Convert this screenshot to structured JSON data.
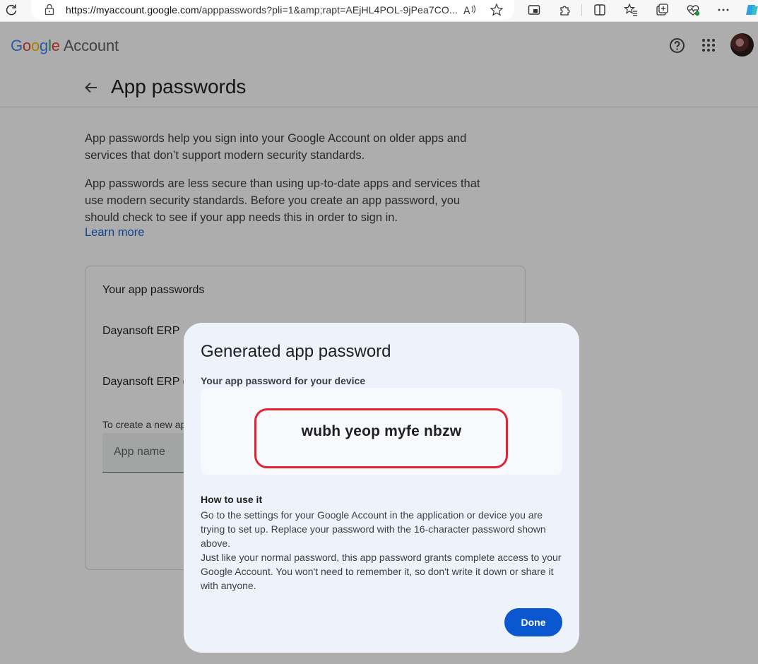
{
  "browser": {
    "url_host": "https://myaccount.google.com",
    "url_rest": "/apppasswords?pli=1&amp;rapt=AEjHL4POL-9jPea7CO..."
  },
  "header": {
    "logo_letters": [
      "G",
      "o",
      "o",
      "g",
      "l",
      "e"
    ],
    "logo_product": "Account"
  },
  "titlebar": {
    "title": "App passwords"
  },
  "intro": {
    "p1": "App passwords help you sign into your Google Account on older apps and services that don’t support modern security standards.",
    "p2": "App passwords are less secure than using up-to-date apps and services that use modern security standards. Before you create an app password, you should check to see if your app needs this in order to sign in.",
    "learn_more": "Learn more"
  },
  "card": {
    "title": "Your app passwords",
    "entries": [
      "Dayansoft ERP",
      "Dayansoft ERP ("
    ],
    "create_hint": "To create a new ap",
    "app_name_placeholder": "App name"
  },
  "dialog": {
    "title": "Generated app password",
    "subtitle": "Your app password for your device",
    "password": "wubh yeop myfe nbzw",
    "howto_title": "How to use it",
    "howto_lines": [
      "Go to the settings for your Google Account in the application or device you are trying to set up. Replace your password with the 16-character password shown above.",
      "Just like your normal password, this app password grants complete access to your Google Account. You won't need to remember it, so don't write it down or share it with anyone."
    ],
    "done_label": "Done"
  },
  "colors": {
    "accent": "#0b57d0",
    "highlight": "#e02431",
    "dialog_bg": "#eef2fa"
  }
}
